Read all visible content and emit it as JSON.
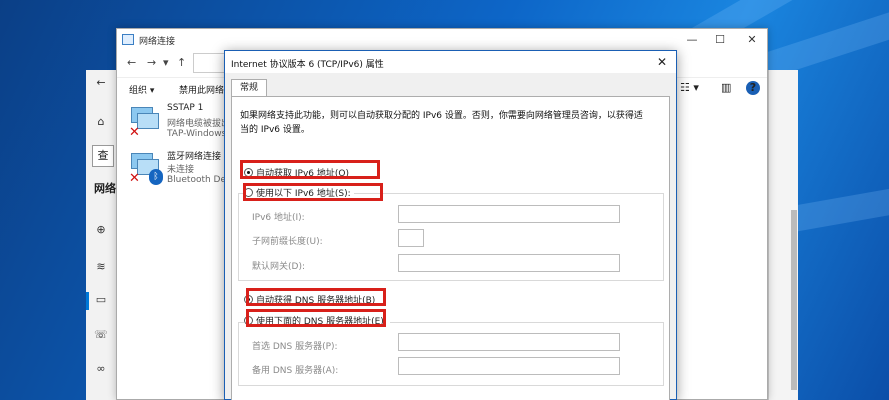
{
  "explorer": {
    "title": "网络连接",
    "controls": {
      "minimize": "—",
      "maximize": "☐",
      "close": "✕"
    },
    "nav": {
      "back": "←",
      "forward": "→",
      "dropdown": "▾",
      "up": "↑"
    },
    "toolbar": {
      "organize": "组织 ▾",
      "disable": "禁用此网络设备"
    },
    "connections": [
      {
        "name": "SSTAP 1",
        "status": "网络电缆被拔出",
        "device": "TAP-Windows"
      },
      {
        "name": "蓝牙网络连接",
        "status": "未连接",
        "device": "Bluetooth De"
      }
    ]
  },
  "settings": {
    "search_glyph": "查",
    "network_label": "网络"
  },
  "dialog": {
    "title": "Internet 协议版本 6 (TCP/IPv6) 属性",
    "close": "✕",
    "tab_general": "常规",
    "description": "如果网络支持此功能，则可以自动获取分配的 IPv6 设置。否则，你需要向网络管理员咨询，以获得适当的 IPv6 设置。",
    "auto_ip": "自动获取 IPv6 地址(O)",
    "manual_ip": "使用以下 IPv6 地址(S):",
    "ipv6_address_label": "IPv6 地址(I):",
    "prefix_label": "子网前缀长度(U):",
    "gateway_label": "默认网关(D):",
    "auto_dns": "自动获得 DNS 服务器地址(B)",
    "manual_dns": "使用下面的 DNS 服务器地址(E):",
    "preferred_dns_label": "首选 DNS 服务器(P):",
    "alternate_dns_label": "备用 DNS 服务器(A):"
  },
  "colors": {
    "highlight": "#d8201a",
    "accent": "#1a5fb4"
  }
}
